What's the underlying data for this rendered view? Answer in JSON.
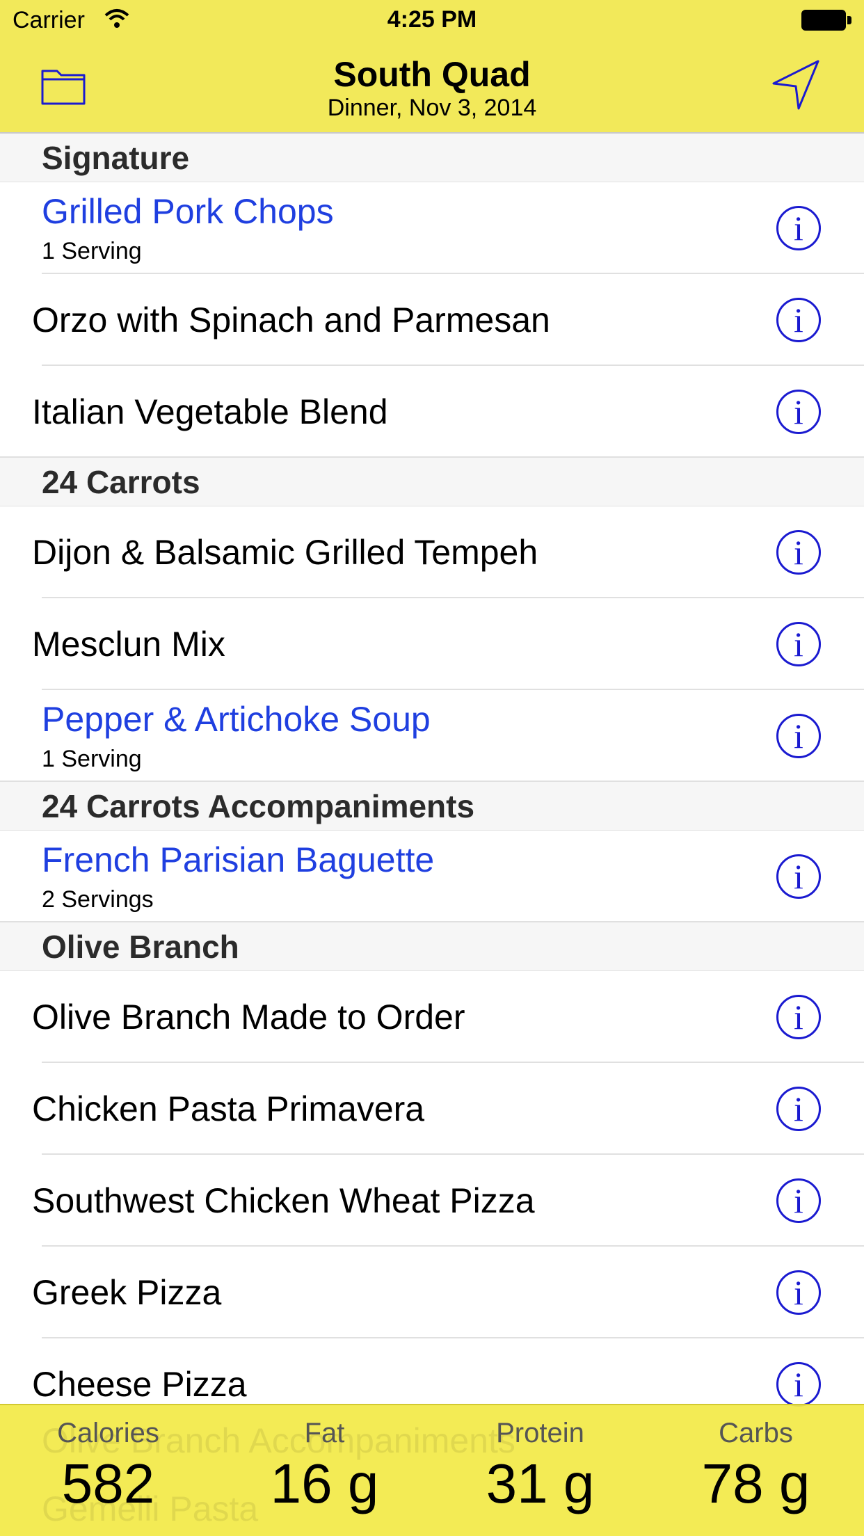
{
  "status_bar": {
    "carrier": "Carrier",
    "time": "4:25 PM"
  },
  "nav": {
    "title": "South Quad",
    "subtitle": "Dinner, Nov 3, 2014",
    "left_icon": "folder-icon",
    "right_icon": "location-arrow-icon"
  },
  "colors": {
    "bar": "#f2e95a",
    "selected_text": "#1f3fe0",
    "info_icon": "#1a1ad0"
  },
  "sections": [
    {
      "header": "Signature",
      "items": [
        {
          "title": "Grilled Pork Chops",
          "sub": "1 Serving",
          "selected": true
        },
        {
          "title": "Orzo with Spinach and Parmesan"
        },
        {
          "title": "Italian Vegetable Blend"
        }
      ]
    },
    {
      "header": "24 Carrots",
      "items": [
        {
          "title": "Dijon & Balsamic Grilled Tempeh"
        },
        {
          "title": "Mesclun Mix"
        },
        {
          "title": "Pepper & Artichoke Soup",
          "sub": "1 Serving",
          "selected": true
        }
      ]
    },
    {
      "header": "24 Carrots Accompaniments",
      "items": [
        {
          "title": "French Parisian Baguette",
          "sub": "2 Servings",
          "selected": true
        }
      ]
    },
    {
      "header": "Olive Branch",
      "items": [
        {
          "title": "Olive Branch Made to Order"
        },
        {
          "title": "Chicken Pasta Primavera"
        },
        {
          "title": "Southwest Chicken Wheat Pizza"
        },
        {
          "title": "Greek Pizza"
        },
        {
          "title": "Cheese Pizza"
        }
      ]
    }
  ],
  "behind_bar": {
    "section": "Olive Branch Accompaniments",
    "item": "Gemelli Pasta"
  },
  "totals": [
    {
      "label": "Calories",
      "value": "582"
    },
    {
      "label": "Fat",
      "value": "16 g"
    },
    {
      "label": "Protein",
      "value": "31 g"
    },
    {
      "label": "Carbs",
      "value": "78 g"
    }
  ]
}
